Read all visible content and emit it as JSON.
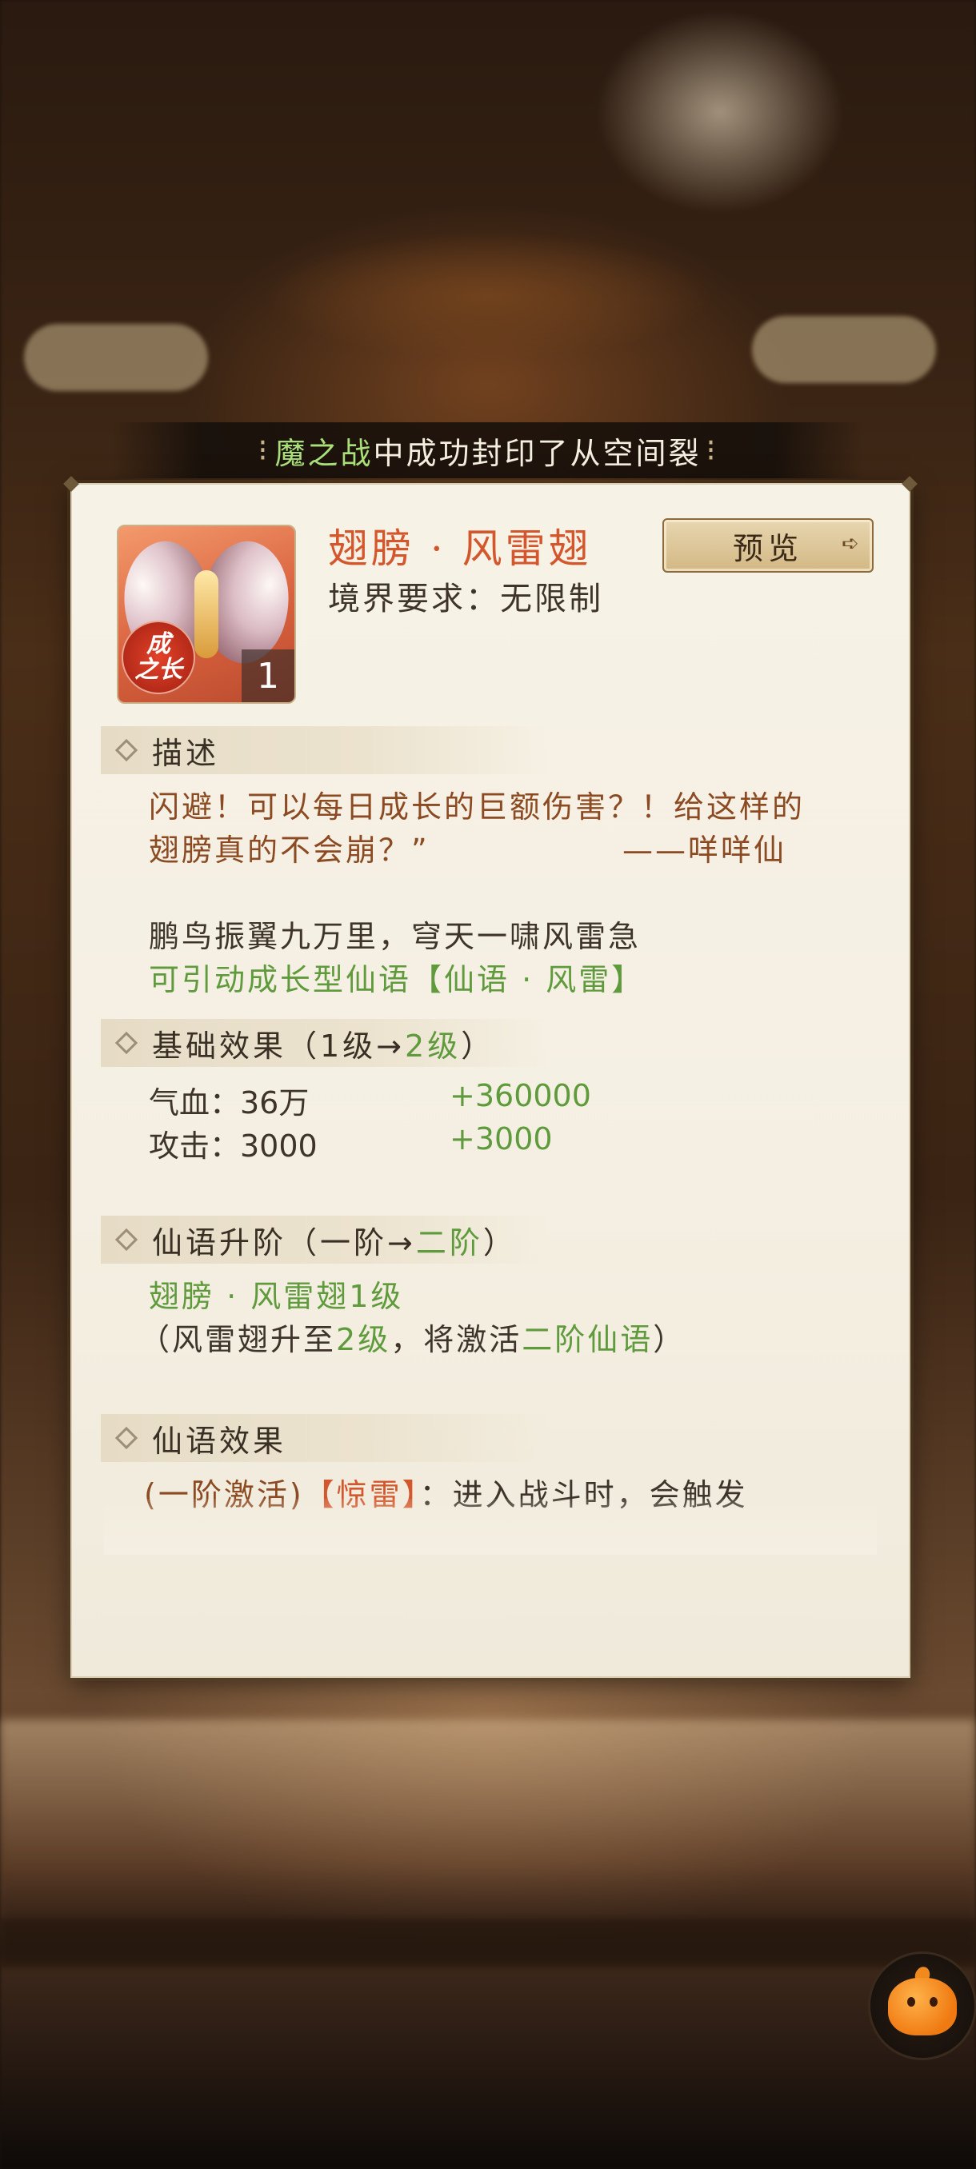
{
  "ticker": {
    "prefix": "",
    "highlight": "魔之战",
    "rest": "中成功封印了从空间裂"
  },
  "item": {
    "title": "翅膀 · 风雷翅",
    "requirement": "境界要求：无限制",
    "badge_line1": "成",
    "badge_line2": "之长",
    "count": "1",
    "preview_label": "预览"
  },
  "description": {
    "header": "描述",
    "quote_line1": "闪避！可以每日成长的巨额伤害？！给这样的",
    "quote_line2": "翅膀真的不会崩？”",
    "author": "——咩咩仙",
    "poem": "鹏鸟振翼九万里，穹天一啸风雷急",
    "hint": "可引动成长型仙语【仙语 · 风雷】"
  },
  "base_effect": {
    "header_prefix": "基础效果（1级→",
    "header_highlight": "2级",
    "header_suffix": "）",
    "stats": [
      {
        "label": "气血：36万",
        "bonus": "+360000"
      },
      {
        "label": "攻击：3000",
        "bonus": "+3000"
      }
    ]
  },
  "upgrade": {
    "header_prefix": "仙语升阶（一阶→",
    "header_highlight": "二阶",
    "header_suffix": "）",
    "line1": "翅膀 · 风雷翅1级",
    "line2_a": "（风雷翅升至",
    "line2_b": "2级",
    "line2_c": "，将激活",
    "line2_d": "二阶仙语",
    "line2_e": "）"
  },
  "immortal_effect": {
    "header": "仙语效果",
    "line1_a": "(一阶激活)",
    "line1_b": "【惊雷】",
    "line1_c": "：进入战斗时，会触发"
  },
  "colors": {
    "title": "#d4562c",
    "accent_green": "#5f9a3c",
    "quote_brown": "#8b4a22",
    "panel_bg": "#f4efe2"
  }
}
